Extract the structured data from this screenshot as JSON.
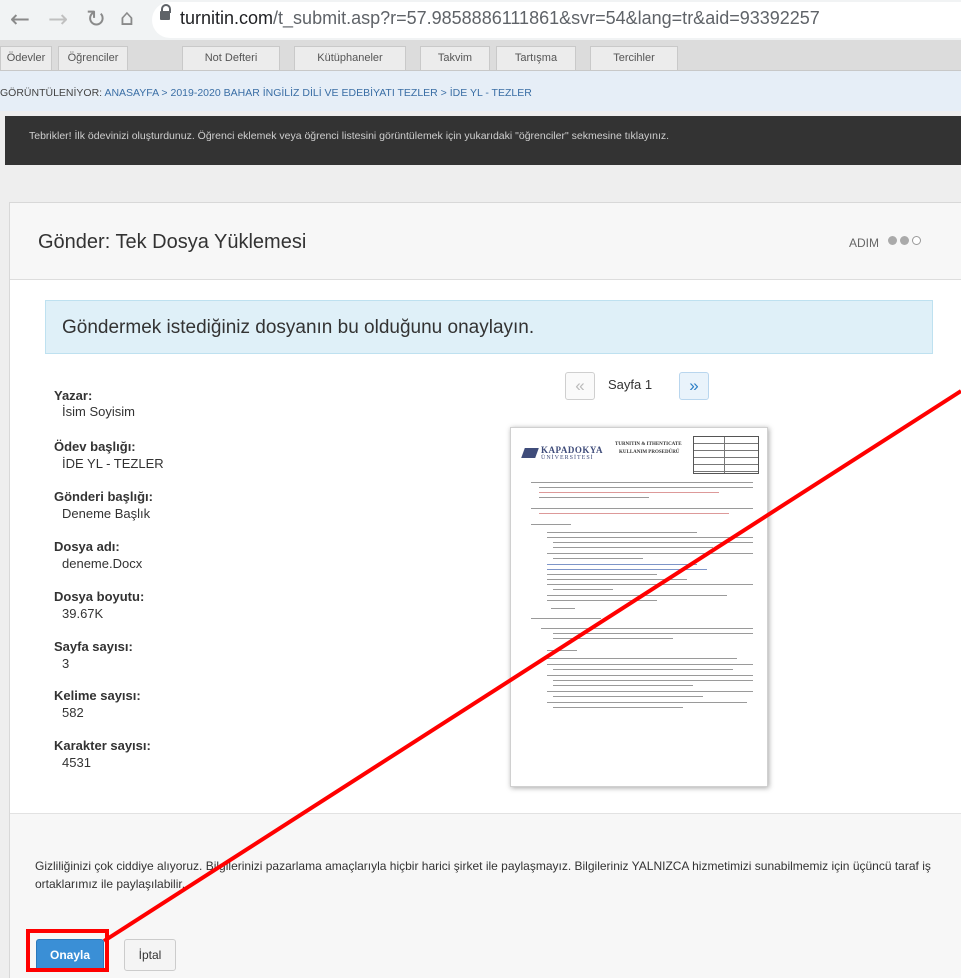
{
  "browser": {
    "url_host": "turnitin.com",
    "url_path": "/t_submit.asp?r=57.9858886111861&svr=54&lang=tr&aid=93392257"
  },
  "tabs": [
    "Ödevler",
    "Öğrenciler",
    "Not Defteri",
    "Kütüphaneler",
    "Takvim",
    "Tartışma",
    "Tercihler"
  ],
  "breadcrumb": {
    "prefix": "GÖRÜNTÜLENİYOR: ",
    "path": "ANASAYFA > 2019-2020 BAHAR İNGİLİZ DİLİ VE EDEBİYATI TEZLER > İDE YL - TEZLER"
  },
  "notice": "Tebrikler! İlk ödevinizi oluşturdunuz. Öğrenci eklemek veya öğrenci listesini görüntülemek için yukarıdaki \"öğrenciler\" sekmesine tıklayınız.",
  "panel": {
    "title": "Gönder: Tek Dosya Yüklemesi",
    "step_label": "ADIM",
    "confirm_message": "Göndermek istediğiniz dosyanın bu olduğunu onaylayın."
  },
  "metadata": [
    {
      "label": "Yazar:",
      "value": "İsim Soyisim"
    },
    {
      "label": "Ödev başlığı:",
      "value": "İDE YL - TEZLER"
    },
    {
      "label": "Gönderi başlığı:",
      "value": "Deneme Başlık"
    },
    {
      "label": "Dosya adı:",
      "value": "deneme.Docx"
    },
    {
      "label": "Dosya boyutu:",
      "value": "39.67K"
    },
    {
      "label": "Sayfa sayısı:",
      "value": "3"
    },
    {
      "label": "Kelime sayısı:",
      "value": "582"
    },
    {
      "label": "Karakter sayısı:",
      "value": "4531"
    }
  ],
  "pager": {
    "prev": "«",
    "label": "Sayfa 1",
    "next": "»"
  },
  "document_preview": {
    "brand": "KAPADOKYA",
    "brand_sub": "ÜNİVERSİTESİ",
    "heading_line1": "TURNITIN & ITHENTICATE",
    "heading_line2": "KULLANIM PROSEDÜRÜ"
  },
  "privacy": "Gizliliğinizi çok ciddiye alıyoruz. Bilgilerinizi pazarlama amaçlarıyla hiçbir harici şirket ile paylaşmayız. Bilgileriniz YALNIZCA hizmetimizi sunabilmemiz için üçüncü taraf iş ortaklarımız ile paylaşılabilir.",
  "buttons": {
    "confirm": "Onayla",
    "cancel": "İptal"
  },
  "colors": {
    "accent": "#3a8fd6",
    "annotation": "#ff0000",
    "notice_bg": "#333333",
    "confirm_bg": "#dff0f8"
  }
}
